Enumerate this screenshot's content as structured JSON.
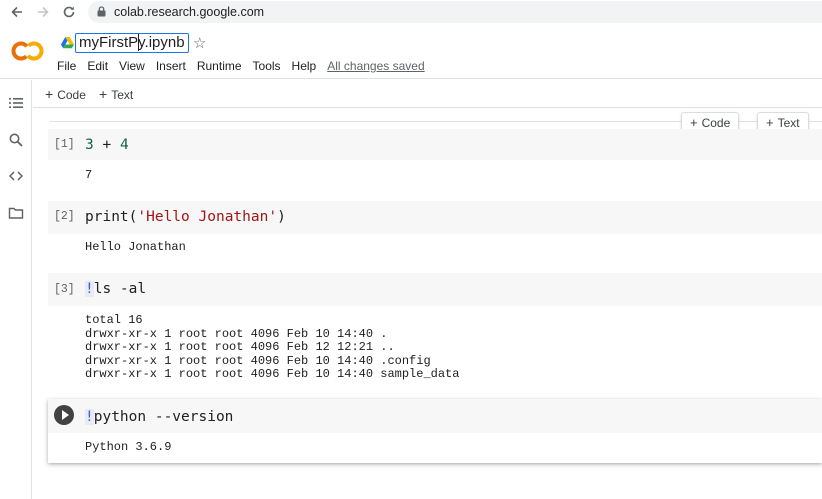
{
  "browser": {
    "url": "colab.research.google.com"
  },
  "notebook": {
    "title": "myFirstPy.ipynb",
    "menu": [
      "File",
      "Edit",
      "View",
      "Insert",
      "Runtime",
      "Tools",
      "Help"
    ],
    "save_status": "All changes saved"
  },
  "toolbar": {
    "code_label": "Code",
    "text_label": "Text"
  },
  "colors": {
    "brand_orange": "#f9ab00",
    "accent_blue": "#1a73e8"
  },
  "cells": [
    {
      "count": "[1]",
      "code": {
        "a": "3",
        "op": " + ",
        "b": "4"
      },
      "output": "7"
    },
    {
      "count": "[2]",
      "code": {
        "fn": "print",
        "open": "(",
        "str": "'Hello Jonathan'",
        "close": ")"
      },
      "output": "Hello Jonathan"
    },
    {
      "count": "[3]",
      "code": {
        "bang": "!",
        "rest": "ls -al"
      },
      "output": [
        "total 16",
        "drwxr-xr-x 1 root root 4096 Feb 10 14:40 .",
        "drwxr-xr-x 1 root root 4096 Feb 12 12:21 ..",
        "drwxr-xr-x 1 root root 4096 Feb 10 14:40 .config",
        "drwxr-xr-x 1 root root 4096 Feb 10 14:40 sample_data"
      ]
    },
    {
      "code": {
        "bang": "!",
        "rest": "python --version"
      },
      "output": "Python 3.6.9"
    }
  ]
}
